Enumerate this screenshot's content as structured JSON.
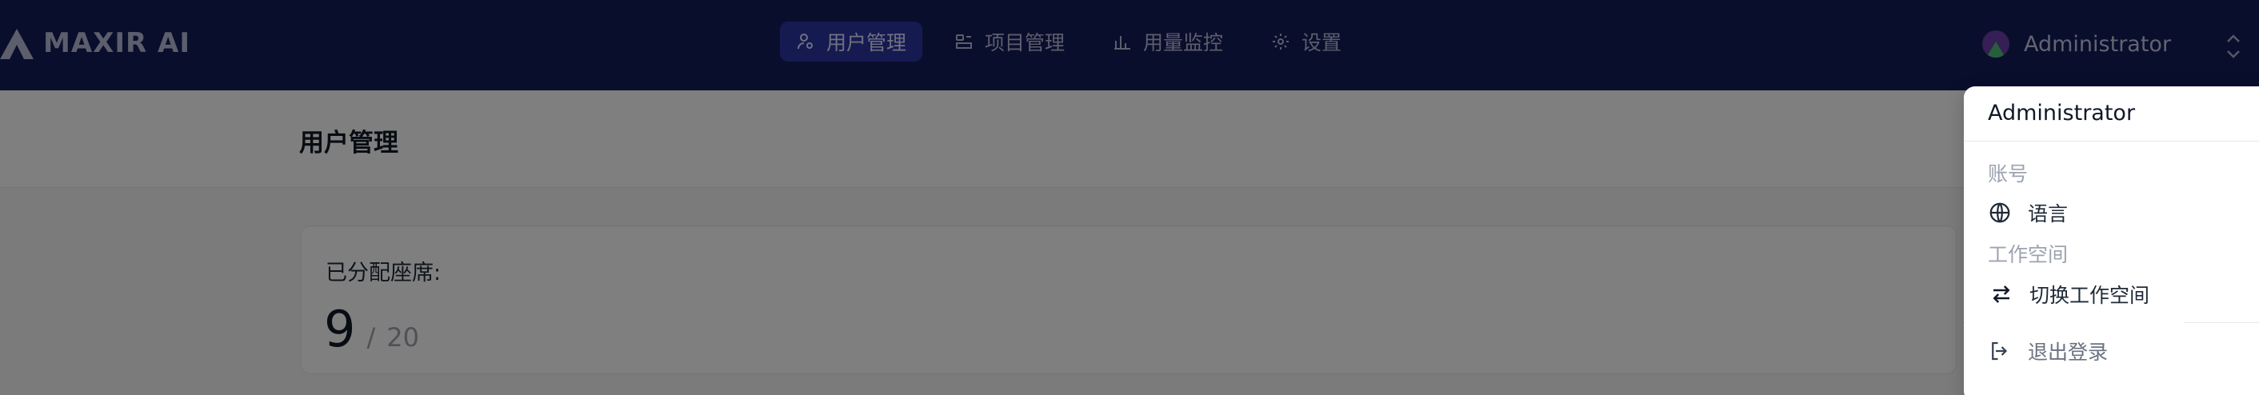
{
  "brand": {
    "name": "MAXIR AI"
  },
  "nav": {
    "items": [
      {
        "label": "用户管理",
        "icon": "user-settings-icon",
        "active": true
      },
      {
        "label": "项目管理",
        "icon": "project-icon",
        "active": false
      },
      {
        "label": "用量监控",
        "icon": "bar-chart-icon",
        "active": false
      },
      {
        "label": "设置",
        "icon": "gear-icon",
        "active": false
      }
    ]
  },
  "user": {
    "name": "Administrator"
  },
  "page": {
    "title": "用户管理"
  },
  "seats": {
    "label": "已分配座席:",
    "used": "9",
    "separator": "/",
    "total": "20"
  },
  "menu": {
    "user": "Administrator",
    "account_section": "账号",
    "language_label": "语言",
    "workspace_section": "工作空间",
    "switch_workspace_label": "切换工作空间",
    "logout_label": "退出登录"
  },
  "colors": {
    "nav_bg": "#151c5b",
    "nav_active": "#2a35a3",
    "overlay": "rgba(0,0,0,0.5)"
  }
}
